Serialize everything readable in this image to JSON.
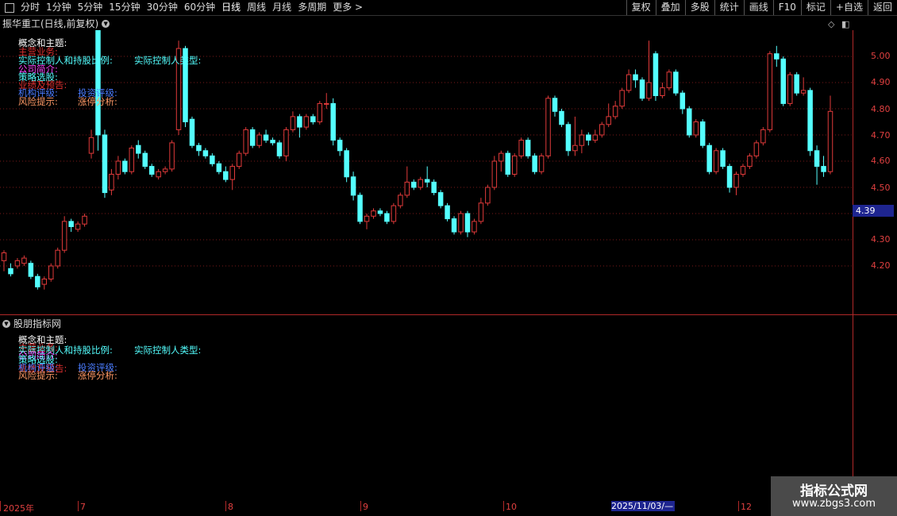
{
  "toolbar": {
    "periods": [
      "分时",
      "1分钟",
      "5分钟",
      "15分钟",
      "30分钟",
      "60分钟",
      "日线",
      "周线",
      "月线",
      "多周期",
      "更多"
    ],
    "more_arrow": ">",
    "right_buttons": [
      "复权",
      "叠加",
      "多股",
      "统计",
      "画线",
      "F10",
      "标记",
      "+自选",
      "返回"
    ]
  },
  "main_panel": {
    "title": "振华重工(日线,前复权)",
    "indicators": {
      "concept": "概念和主题:",
      "main_business": "主营业务:",
      "controller": "实际控制人和持股比例:",
      "controller_type": "实际控制人类型:",
      "company": "公司简介:",
      "strategy": "策略选股:",
      "earnings": "业绩及预告:",
      "institution": "机构评级:",
      "invest": "投资评级:",
      "risk": "风险提示:",
      "limit_up": "涨停分析:"
    },
    "current_price": "4.39",
    "price_levels": [
      "5.00",
      "4.90",
      "4.80",
      "4.70",
      "4.60",
      "4.50",
      "4.30",
      "4.20"
    ]
  },
  "sub_panel": {
    "title": "股朋指标网",
    "indicators": {
      "concept": "概念和主题:",
      "main_business": "主营业务:",
      "controller": "实际控制人和持股比例:",
      "controller_type": "实际控制人类型:",
      "company": "公司简介:",
      "strategy": "策略选股:",
      "earnings": "业绩及预告:",
      "institution": "机构评级:",
      "invest": "投资评级:",
      "risk": "风险提示:",
      "limit_up": "涨停分析:"
    }
  },
  "date_axis": {
    "labels": [
      "2025年",
      "7",
      "8",
      "9",
      "10",
      "12"
    ],
    "highlight": "2025/11/03/—"
  },
  "watermark": {
    "line1": "指标公式网",
    "line2": "www.zbgs3.com"
  },
  "colors": {
    "up": "#e03a3a",
    "down": "#54ffff",
    "grid": "#7a1a1a",
    "axis": "#b02828"
  },
  "chart_data": {
    "type": "candlestick",
    "y_range": [
      4.08,
      5.1
    ],
    "candles": [
      [
        4.22,
        4.25,
        4.18,
        4.26
      ],
      [
        4.19,
        4.17,
        4.16,
        4.21
      ],
      [
        4.2,
        4.22,
        4.19,
        4.23
      ],
      [
        4.21,
        4.23,
        4.2,
        4.24
      ],
      [
        4.21,
        4.16,
        4.15,
        4.22
      ],
      [
        4.16,
        4.12,
        4.11,
        4.17
      ],
      [
        4.13,
        4.15,
        4.11,
        4.16
      ],
      [
        4.15,
        4.2,
        4.14,
        4.21
      ],
      [
        4.2,
        4.26,
        4.19,
        4.27
      ],
      [
        4.26,
        4.37,
        4.25,
        4.39
      ],
      [
        4.37,
        4.35,
        4.33,
        4.38
      ],
      [
        4.34,
        4.36,
        4.33,
        4.37
      ],
      [
        4.36,
        4.39,
        4.35,
        4.4
      ],
      [
        4.63,
        4.69,
        4.61,
        4.72
      ],
      [
        5.1,
        4.7,
        4.64,
        5.1
      ],
      [
        4.7,
        4.48,
        4.46,
        4.72
      ],
      [
        4.49,
        4.55,
        4.47,
        4.57
      ],
      [
        4.55,
        4.6,
        4.53,
        4.62
      ],
      [
        4.6,
        4.56,
        4.55,
        4.61
      ],
      [
        4.56,
        4.65,
        4.55,
        4.66
      ],
      [
        4.66,
        4.63,
        4.61,
        4.68
      ],
      [
        4.63,
        4.58,
        4.57,
        4.64
      ],
      [
        4.58,
        4.55,
        4.54,
        4.59
      ],
      [
        4.54,
        4.56,
        4.53,
        4.57
      ],
      [
        4.56,
        4.57,
        4.55,
        4.58
      ],
      [
        4.57,
        4.67,
        4.56,
        4.68
      ],
      [
        4.72,
        5.03,
        4.7,
        5.06
      ],
      [
        5.03,
        4.75,
        4.73,
        5.04
      ],
      [
        4.76,
        4.66,
        4.65,
        4.77
      ],
      [
        4.66,
        4.64,
        4.62,
        4.67
      ],
      [
        4.64,
        4.62,
        4.61,
        4.65
      ],
      [
        4.62,
        4.59,
        4.58,
        4.63
      ],
      [
        4.59,
        4.56,
        4.55,
        4.6
      ],
      [
        4.56,
        4.53,
        4.52,
        4.58
      ],
      [
        4.53,
        4.58,
        4.49,
        4.59
      ],
      [
        4.58,
        4.63,
        4.57,
        4.64
      ],
      [
        4.63,
        4.72,
        4.62,
        4.73
      ],
      [
        4.72,
        4.66,
        4.65,
        4.73
      ],
      [
        4.66,
        4.7,
        4.65,
        4.71
      ],
      [
        4.7,
        4.68,
        4.67,
        4.72
      ],
      [
        4.68,
        4.67,
        4.66,
        4.69
      ],
      [
        4.67,
        4.62,
        4.61,
        4.68
      ],
      [
        4.62,
        4.72,
        4.6,
        4.73
      ],
      [
        4.72,
        4.77,
        4.71,
        4.79
      ],
      [
        4.77,
        4.73,
        4.69,
        4.78
      ],
      [
        4.73,
        4.77,
        4.72,
        4.78
      ],
      [
        4.77,
        4.75,
        4.74,
        4.78
      ],
      [
        4.75,
        4.82,
        4.74,
        4.83
      ],
      [
        4.82,
        4.82,
        4.8,
        4.86
      ],
      [
        4.82,
        4.68,
        4.66,
        4.84
      ],
      [
        4.68,
        4.64,
        4.62,
        4.69
      ],
      [
        4.64,
        4.54,
        4.52,
        4.65
      ],
      [
        4.54,
        4.47,
        4.45,
        4.56
      ],
      [
        4.47,
        4.37,
        4.36,
        4.48
      ],
      [
        4.37,
        4.39,
        4.34,
        4.4
      ],
      [
        4.39,
        4.41,
        4.38,
        4.42
      ],
      [
        4.41,
        4.4,
        4.39,
        4.42
      ],
      [
        4.4,
        4.37,
        4.36,
        4.41
      ],
      [
        4.37,
        4.43,
        4.36,
        4.44
      ],
      [
        4.43,
        4.47,
        4.42,
        4.48
      ],
      [
        4.47,
        4.52,
        4.46,
        4.58
      ],
      [
        4.52,
        4.5,
        4.49,
        4.53
      ],
      [
        4.5,
        4.53,
        4.49,
        4.54
      ],
      [
        4.53,
        4.52,
        4.5,
        4.58
      ],
      [
        4.52,
        4.48,
        4.47,
        4.53
      ],
      [
        4.48,
        4.43,
        4.42,
        4.49
      ],
      [
        4.43,
        4.38,
        4.37,
        4.44
      ],
      [
        4.38,
        4.33,
        4.32,
        4.39
      ],
      [
        4.33,
        4.4,
        4.32,
        4.41
      ],
      [
        4.4,
        4.33,
        4.31,
        4.41
      ],
      [
        4.33,
        4.37,
        4.32,
        4.38
      ],
      [
        4.37,
        4.44,
        4.36,
        4.46
      ],
      [
        4.44,
        4.5,
        4.43,
        4.51
      ],
      [
        4.5,
        4.6,
        4.49,
        4.62
      ],
      [
        4.6,
        4.63,
        4.56,
        4.64
      ],
      [
        4.63,
        4.55,
        4.54,
        4.64
      ],
      [
        4.55,
        4.62,
        4.54,
        4.63
      ],
      [
        4.62,
        4.68,
        4.61,
        4.69
      ],
      [
        4.68,
        4.62,
        4.61,
        4.69
      ],
      [
        4.62,
        4.56,
        4.55,
        4.63
      ],
      [
        4.56,
        4.62,
        4.55,
        4.63
      ],
      [
        4.62,
        4.84,
        4.61,
        4.85
      ],
      [
        4.84,
        4.79,
        4.77,
        4.85
      ],
      [
        4.79,
        4.74,
        4.73,
        4.8
      ],
      [
        4.74,
        4.64,
        4.62,
        4.75
      ],
      [
        4.64,
        4.66,
        4.62,
        4.77
      ],
      [
        4.66,
        4.7,
        4.63,
        4.72
      ],
      [
        4.7,
        4.68,
        4.66,
        4.71
      ],
      [
        4.68,
        4.7,
        4.67,
        4.72
      ],
      [
        4.7,
        4.74,
        4.69,
        4.75
      ],
      [
        4.74,
        4.77,
        4.73,
        4.82
      ],
      [
        4.77,
        4.81,
        4.76,
        4.83
      ],
      [
        4.81,
        4.87,
        4.8,
        4.88
      ],
      [
        4.87,
        4.93,
        4.86,
        4.95
      ],
      [
        4.93,
        4.91,
        4.88,
        4.95
      ],
      [
        4.91,
        4.84,
        4.83,
        4.92
      ],
      [
        4.84,
        4.9,
        4.83,
        5.06
      ],
      [
        5.01,
        4.85,
        4.83,
        5.02
      ],
      [
        4.85,
        4.88,
        4.84,
        4.9
      ],
      [
        4.88,
        4.94,
        4.87,
        4.95
      ],
      [
        4.94,
        4.86,
        4.85,
        4.95
      ],
      [
        4.86,
        4.8,
        4.78,
        4.87
      ],
      [
        4.8,
        4.7,
        4.69,
        4.81
      ],
      [
        4.7,
        4.75,
        4.69,
        4.76
      ],
      [
        4.75,
        4.66,
        4.65,
        4.76
      ],
      [
        4.66,
        4.56,
        4.55,
        4.67
      ],
      [
        4.56,
        4.64,
        4.55,
        4.65
      ],
      [
        4.64,
        4.58,
        4.57,
        4.65
      ],
      [
        4.58,
        4.5,
        4.48,
        4.59
      ],
      [
        4.5,
        4.55,
        4.47,
        4.56
      ],
      [
        4.55,
        4.58,
        4.54,
        4.59
      ],
      [
        4.58,
        4.62,
        4.57,
        4.63
      ],
      [
        4.62,
        4.67,
        4.61,
        4.68
      ],
      [
        4.67,
        4.72,
        4.66,
        4.73
      ],
      [
        4.72,
        5.01,
        4.71,
        5.02
      ],
      [
        5.01,
        4.99,
        4.96,
        5.04
      ],
      [
        4.99,
        4.82,
        4.81,
        5.0
      ],
      [
        4.82,
        4.93,
        4.81,
        4.94
      ],
      [
        4.93,
        4.86,
        4.85,
        4.94
      ],
      [
        4.86,
        4.87,
        4.85,
        4.92
      ],
      [
        4.87,
        4.64,
        4.62,
        4.88
      ],
      [
        4.64,
        4.58,
        4.51,
        4.66
      ],
      [
        4.58,
        4.56,
        4.54,
        4.62
      ],
      [
        4.56,
        4.79,
        4.55,
        4.85
      ]
    ]
  }
}
